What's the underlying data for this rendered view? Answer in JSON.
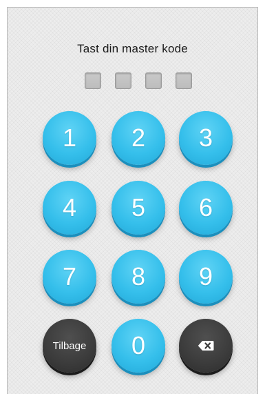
{
  "prompt": "Tast din master kode",
  "code_slots": 4,
  "keys": [
    "1",
    "2",
    "3",
    "4",
    "5",
    "6",
    "7",
    "8",
    "9",
    "0"
  ],
  "back_label": "Tilbage",
  "colors": {
    "key_blue": "#35bfeb",
    "key_dark": "#3b3b3b",
    "background": "#ededed"
  },
  "icons": {
    "delete": "backspace-icon"
  }
}
